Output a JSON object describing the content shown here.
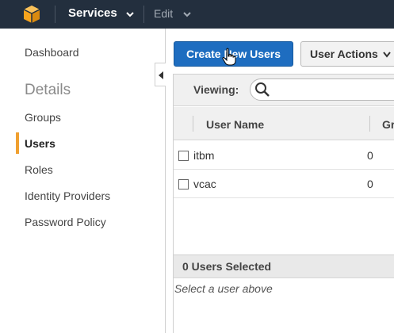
{
  "topbar": {
    "logo_icon": "aws-cube-icon",
    "services_label": "Services",
    "edit_label": "Edit"
  },
  "sidebar": {
    "dashboard": "Dashboard",
    "section_heading": "Details",
    "items": [
      {
        "label": "Groups",
        "active": false
      },
      {
        "label": "Users",
        "active": true
      },
      {
        "label": "Roles",
        "active": false
      },
      {
        "label": "Identity Providers",
        "active": false
      },
      {
        "label": "Password Policy",
        "active": false
      }
    ],
    "accent_color": "#f0a030"
  },
  "toolbar": {
    "create_label": "Create New Users",
    "actions_label": "User Actions"
  },
  "filter": {
    "viewing_label": "Viewing:",
    "search_value": ""
  },
  "table": {
    "columns": [
      "User Name",
      "Gr"
    ],
    "rows": [
      {
        "name": "itbm",
        "groups": "0"
      },
      {
        "name": "vcac",
        "groups": "0"
      }
    ]
  },
  "selection": {
    "count_text": "0 Users Selected",
    "hint": "Select a user above"
  },
  "colors": {
    "topbar_bg": "#232f3e",
    "primary_button": "#1e6dc0"
  }
}
